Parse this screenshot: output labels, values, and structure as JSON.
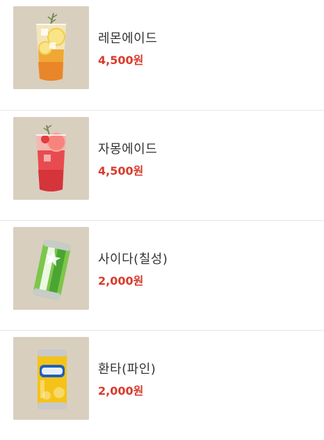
{
  "menu": {
    "items": [
      {
        "name": "레몬에이드",
        "price": "4,500원",
        "image_icon": "lemonade-icon"
      },
      {
        "name": "자몽에이드",
        "price": "4,500원",
        "image_icon": "grapefruit-ade-icon"
      },
      {
        "name": "사이다(칠성)",
        "price": "2,000원",
        "image_icon": "cider-can-icon"
      },
      {
        "name": "환타(파인)",
        "price": "2,000원",
        "image_icon": "fanta-can-icon"
      }
    ],
    "colors": {
      "price": "#d83b2b",
      "name": "#333333",
      "thumb_bg": "#d8cfbf",
      "divider": "#e7e7e7"
    }
  }
}
